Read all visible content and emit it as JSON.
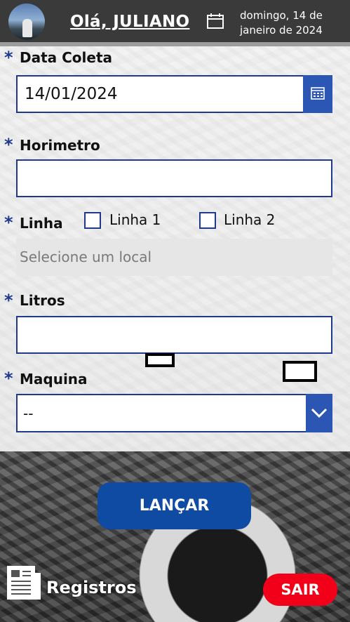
{
  "header": {
    "greeting": "Olá, JULIANO",
    "date_line1": "domingo, 14 de",
    "date_line2": "janeiro de 2024"
  },
  "form": {
    "data_coleta": {
      "required": "*",
      "label": "Data Coleta",
      "value": "14/01/2024"
    },
    "horimetro": {
      "required": "*",
      "label": "Horimetro",
      "value": ""
    },
    "linha": {
      "required": "*",
      "label": "Linha",
      "options": [
        {
          "label": "Linha 1",
          "checked": false
        },
        {
          "label": "Linha 2",
          "checked": false
        }
      ],
      "local_placeholder": "Selecione um local"
    },
    "litros": {
      "required": "*",
      "label": "Litros",
      "value": ""
    },
    "maquina": {
      "required": "*",
      "label": "Maquina",
      "value": "--"
    }
  },
  "actions": {
    "submit_label": "LANÇAR",
    "registros_label": "Registros",
    "logout_label": "SAIR"
  },
  "icons": [
    "avatar",
    "calendar-icon",
    "date-picker-icon",
    "chevron-down-icon",
    "document-icon"
  ],
  "colors": {
    "accent_blue": "#1f3a8c",
    "button_blue": "#0f4aa3",
    "logout_red": "#f2001a",
    "header": "#3a3a3a"
  }
}
